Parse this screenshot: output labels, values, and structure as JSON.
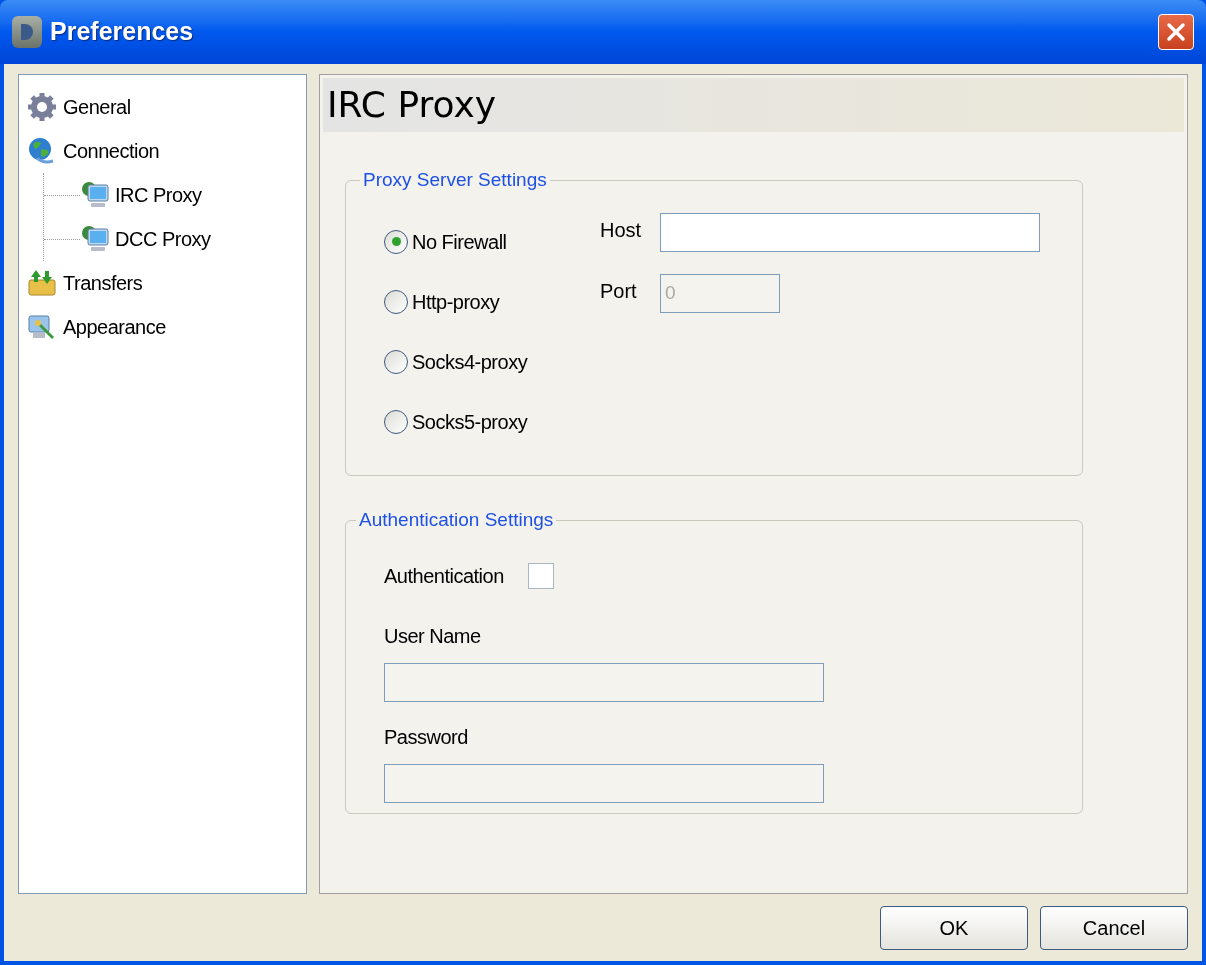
{
  "window": {
    "title": "Preferences"
  },
  "sidebar": {
    "items": [
      {
        "label": "General"
      },
      {
        "label": "Connection",
        "children": [
          {
            "label": "IRC Proxy"
          },
          {
            "label": "DCC Proxy"
          }
        ]
      },
      {
        "label": "Transfers"
      },
      {
        "label": "Appearance"
      }
    ]
  },
  "page_title": "IRC Proxy",
  "proxy_group": {
    "legend": "Proxy Server Settings",
    "options": [
      {
        "label": "No Firewall",
        "selected": true
      },
      {
        "label": "Http-proxy",
        "selected": false
      },
      {
        "label": "Socks4-proxy",
        "selected": false
      },
      {
        "label": "Socks5-proxy",
        "selected": false
      }
    ],
    "host": {
      "label": "Host"
    },
    "port": {
      "label": "Port",
      "value": "0",
      "disabled": true
    }
  },
  "auth_group": {
    "legend": "Authentication Settings",
    "authentication": {
      "label": "Authentication",
      "checked": false
    },
    "user_name": {
      "label": "User Name"
    },
    "password": {
      "label": "Password"
    }
  },
  "buttons": [
    "OK",
    "Cancel"
  ]
}
